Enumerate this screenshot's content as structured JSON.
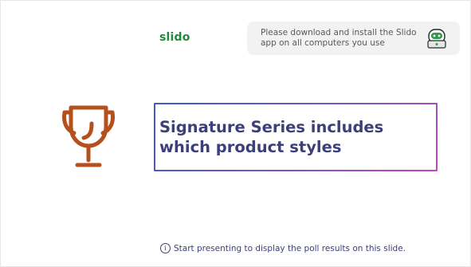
{
  "logo": {
    "text": "slido"
  },
  "banner": {
    "text": "Please download and install the Slido app on all computers you use",
    "icon": "slido-mascot-icon"
  },
  "poll": {
    "icon": "trophy-icon",
    "question": "Signature Series includes which product styles"
  },
  "footer": {
    "icon_glyph": "i",
    "text": "Start presenting to display the poll results on this slide."
  },
  "colors": {
    "brand_green": "#1f8a3a",
    "trophy": "#b4501c",
    "question_text": "#3c3f7a",
    "border_gradient_start": "#3a5bc7",
    "border_gradient_end": "#c246c0"
  }
}
